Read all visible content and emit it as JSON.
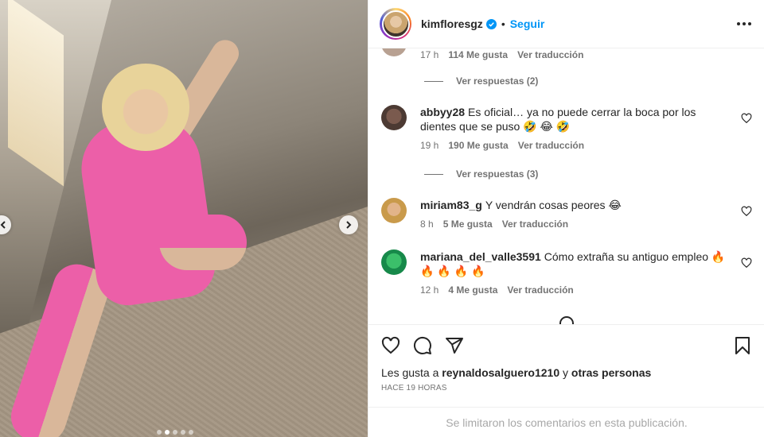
{
  "post": {
    "username": "kimfloresgz",
    "follow_label": "Seguir",
    "separator": "•",
    "likes_prefix": "Les gusta a",
    "likes_user": "reynaldosalguero1210",
    "likes_middle": "y",
    "likes_suffix": "otras personas",
    "time_ago": "HACE 19 HORAS",
    "comments_limited": "Se limitaron los comentarios en esta publicación."
  },
  "comments": [
    {
      "user": "",
      "text": "",
      "time": "17 h",
      "likes": "114 Me gusta",
      "translate": "Ver traducción",
      "replies": "Ver respuestas (2)"
    },
    {
      "user": "abbyy28",
      "text": "Es oficial… ya no puede cerrar la boca por los dientes que se puso 🤣 😂 🤣",
      "time": "19 h",
      "likes": "190 Me gusta",
      "translate": "Ver traducción",
      "replies": "Ver respuestas (3)"
    },
    {
      "user": "miriam83_g",
      "text": "Y vendrán cosas peores 😂",
      "time": "8 h",
      "likes": "5 Me gusta",
      "translate": "Ver traducción"
    },
    {
      "user": "mariana_del_valle3591",
      "text": "Cómo extraña su antiguo empleo 🔥 🔥 🔥 🔥 🔥",
      "time": "12 h",
      "likes": "4 Me gusta",
      "translate": "Ver traducción"
    }
  ],
  "carousel": {
    "current": 1,
    "total": 5
  },
  "colors": {
    "accent": "#0095f6",
    "text": "#262626",
    "muted": "#737373",
    "outfit": "#ec5fa8"
  },
  "icons": [
    "heart-icon",
    "comment-icon",
    "share-icon",
    "bookmark-icon",
    "more-options-icon",
    "verified-badge-icon",
    "chevron-right-icon",
    "chevron-left-icon"
  ]
}
